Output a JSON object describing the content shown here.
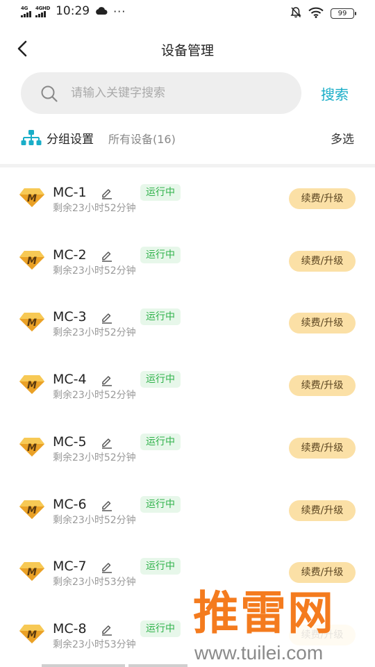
{
  "status_bar": {
    "signal1": "4G",
    "signal2": "4GHD",
    "time": "10:29",
    "more": "···",
    "battery": "99"
  },
  "header": {
    "title": "设备管理"
  },
  "search": {
    "placeholder": "请输入关键字搜索",
    "value": "",
    "button_label": "搜索"
  },
  "group": {
    "label": "分组设置",
    "scope": "所有设备(16)",
    "multi_select": "多选"
  },
  "devices": [
    {
      "name": "MC-1",
      "status": "运行中",
      "remaining": "剩余23小时52分钟",
      "action": "续费/升级"
    },
    {
      "name": "MC-2",
      "status": "运行中",
      "remaining": "剩余23小时52分钟",
      "action": "续费/升级"
    },
    {
      "name": "MC-3",
      "status": "运行中",
      "remaining": "剩余23小时52分钟",
      "action": "续费/升级"
    },
    {
      "name": "MC-4",
      "status": "运行中",
      "remaining": "剩余23小时52分钟",
      "action": "续费/升级"
    },
    {
      "name": "MC-5",
      "status": "运行中",
      "remaining": "剩余23小时52分钟",
      "action": "续费/升级"
    },
    {
      "name": "MC-6",
      "status": "运行中",
      "remaining": "剩余23小时52分钟",
      "action": "续费/升级"
    },
    {
      "name": "MC-7",
      "status": "运行中",
      "remaining": "剩余23小时53分钟",
      "action": "续费/升级"
    },
    {
      "name": "MC-8",
      "status": "运行中",
      "remaining": "剩余23小时53分钟",
      "action": "续费/升级"
    }
  ],
  "watermark": {
    "main": "推雷网",
    "url": "www.tuilei.com"
  },
  "colors": {
    "accent": "#1aaec8",
    "running_text": "#2fb24a",
    "running_bg": "#e7f7ea",
    "renew_bg": "#fbe0a6",
    "badge": "#f2b233",
    "watermark": "#f47b1e"
  },
  "icons": {
    "back": "chevron-left-icon",
    "search": "search-icon",
    "group": "org-tree-icon",
    "device": "diamond-m-icon",
    "edit": "pencil-icon",
    "mute": "bell-off-icon",
    "wifi": "wifi-icon",
    "weather": "cloud-icon"
  }
}
